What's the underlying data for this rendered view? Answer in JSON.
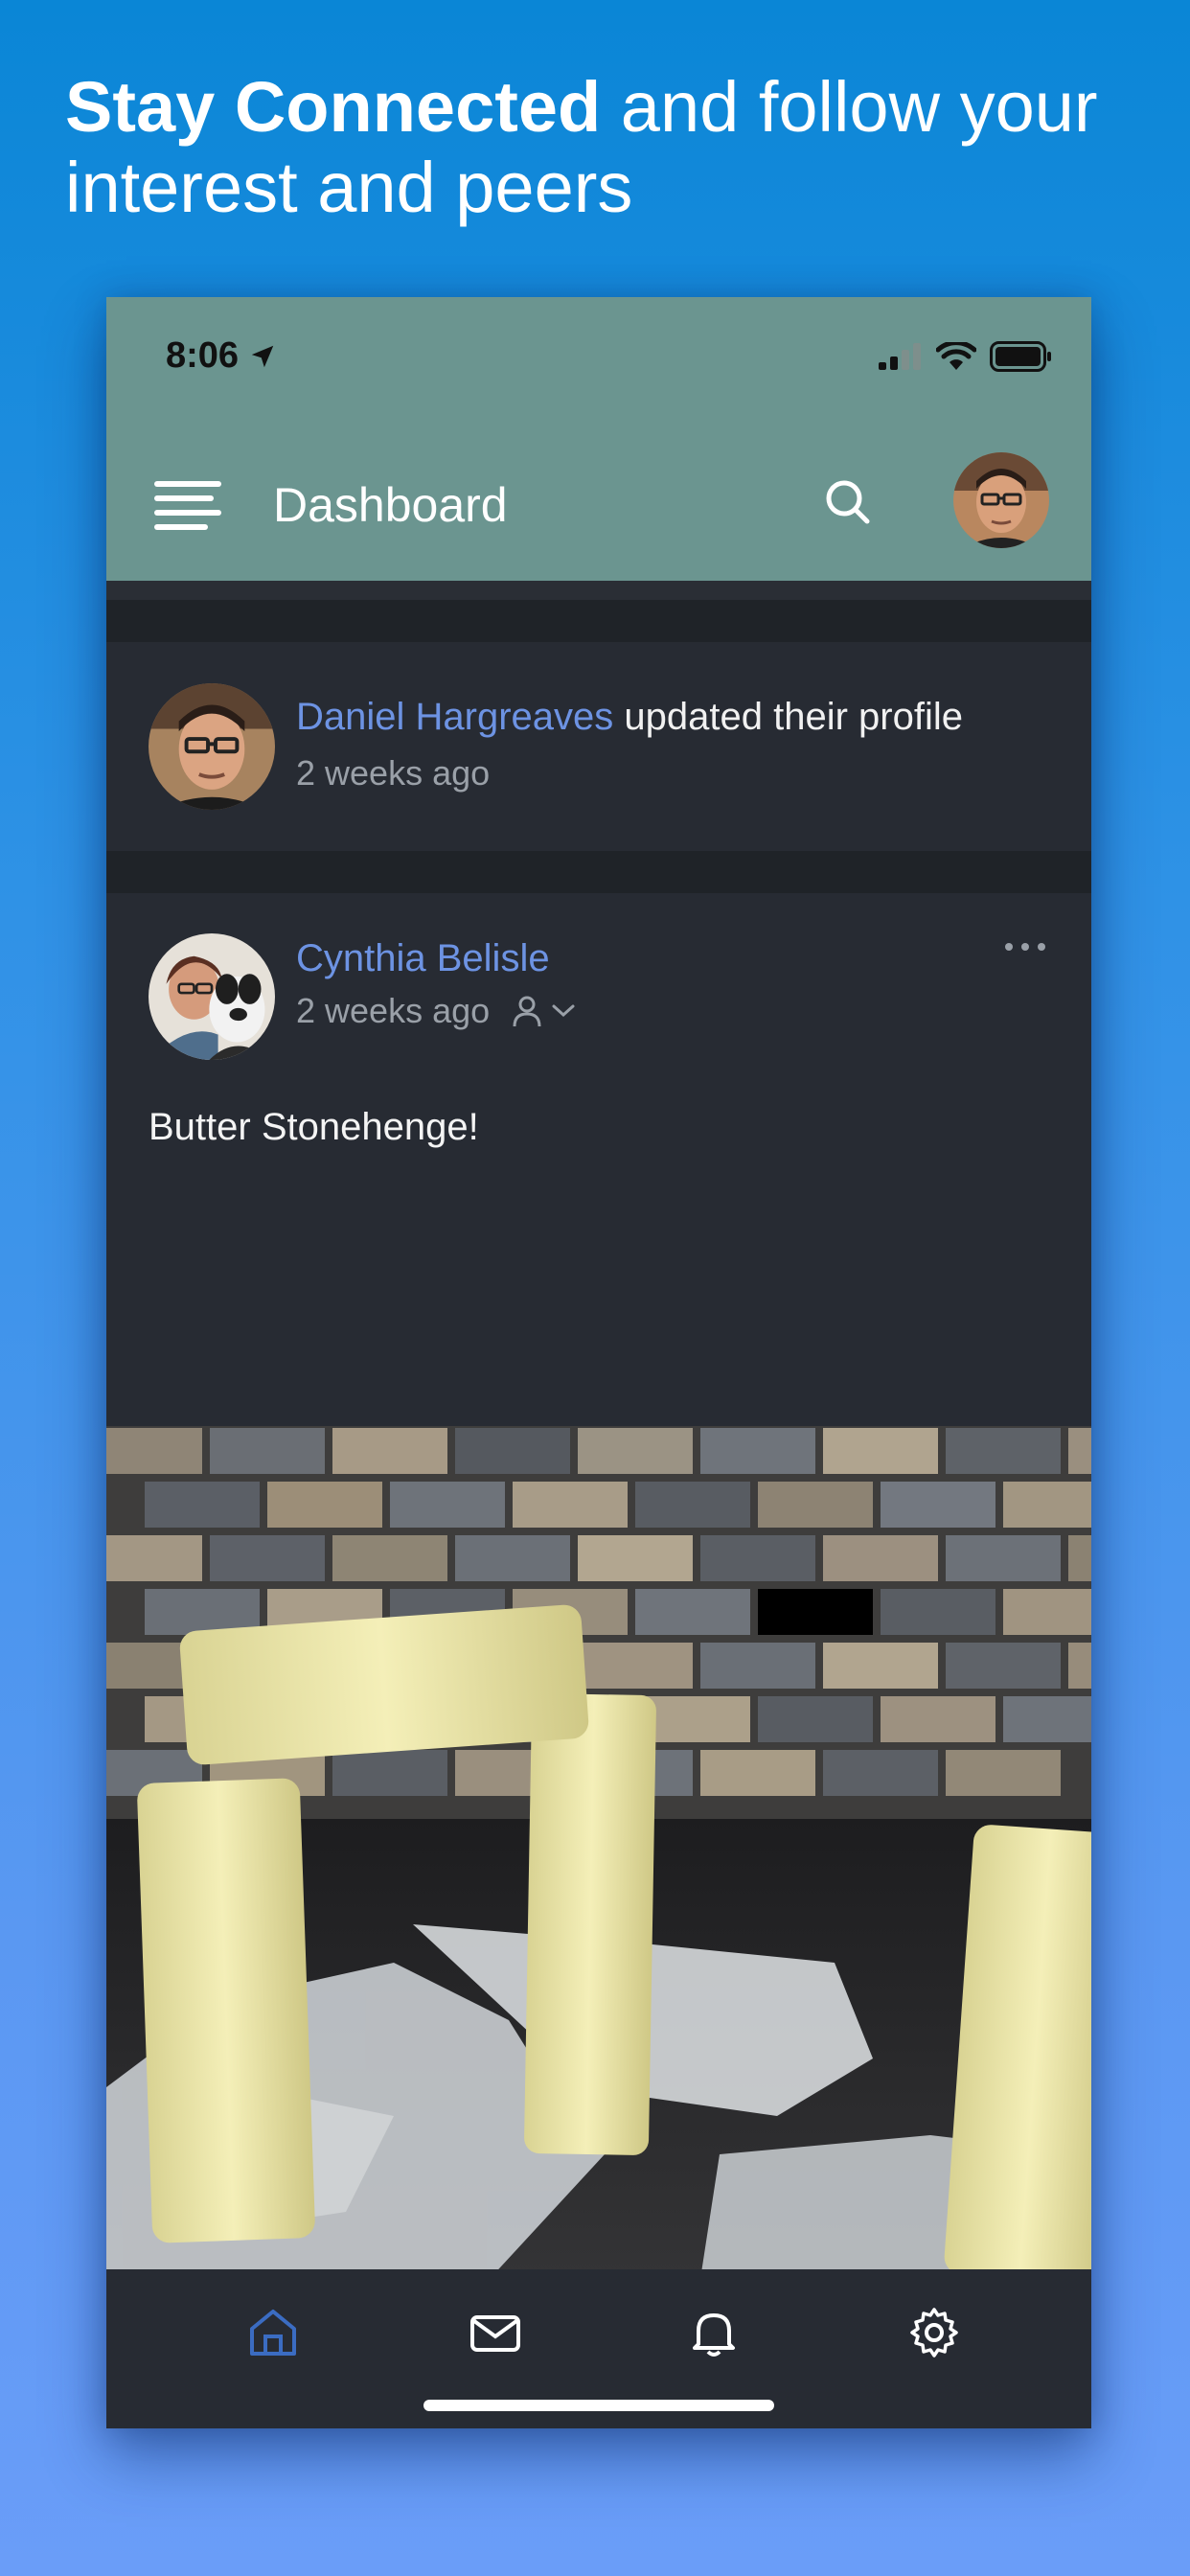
{
  "promo": {
    "headline_bold": "Stay Connected",
    "headline_rest": " and follow your interest and peers"
  },
  "status_bar": {
    "time": "8:06"
  },
  "app_bar": {
    "title": "Dashboard",
    "icons": [
      "menu-icon",
      "search-icon",
      "avatar"
    ]
  },
  "feed": [
    {
      "author": "Daniel Hargreaves",
      "action": " updated their profile",
      "time": "2 weeks ago"
    },
    {
      "author": "Cynthia Belisle",
      "time": "2 weeks ago",
      "text": "Butter Stonehenge!",
      "image": "butter-stonehenge-photo"
    }
  ],
  "tab_bar": {
    "tabs": [
      "home-icon",
      "mail-icon",
      "bell-icon",
      "gear-icon"
    ],
    "active_index": 0
  },
  "colors": {
    "background_top": "#0a86d6",
    "background_bottom": "#6a9df8",
    "app_bar": "#6b9590",
    "surface": "#272b33",
    "link": "#6d93e3",
    "muted": "#9aa0a8",
    "active_tab": "#3b6cc2"
  }
}
